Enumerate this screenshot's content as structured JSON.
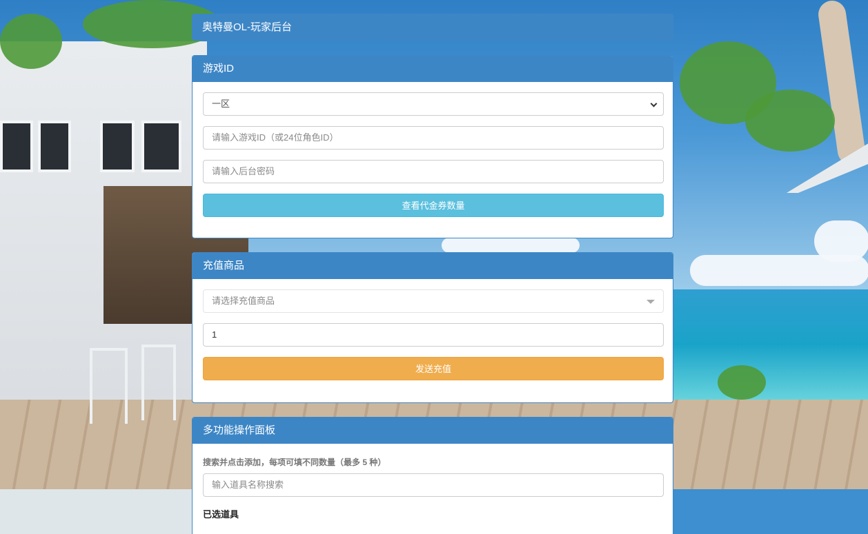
{
  "header": {
    "title": "奥特曼OL-玩家后台"
  },
  "game_id_panel": {
    "title": "游戏ID",
    "zone_select": {
      "selected": "一区"
    },
    "id_input": {
      "placeholder": "请输入游戏ID（或24位角色ID）"
    },
    "password_input": {
      "placeholder": "请输入后台密码"
    },
    "check_button": "查看代金券数量"
  },
  "recharge_panel": {
    "title": "充值商品",
    "product_select": {
      "placeholder": "请选择充值商品"
    },
    "quantity_input": {
      "value": "1"
    },
    "send_button": "发送充值"
  },
  "multi_panel": {
    "title": "多功能操作面板",
    "hint": "搜索并点击添加，每项可填不同数量（最多 5 种）",
    "search_input": {
      "placeholder": "输入道具名称搜索"
    },
    "selected_label": "已选道具"
  },
  "colors": {
    "panel_header": "#3d86c6",
    "info_button": "#5bc0de",
    "warning_button": "#f0ad4e"
  }
}
